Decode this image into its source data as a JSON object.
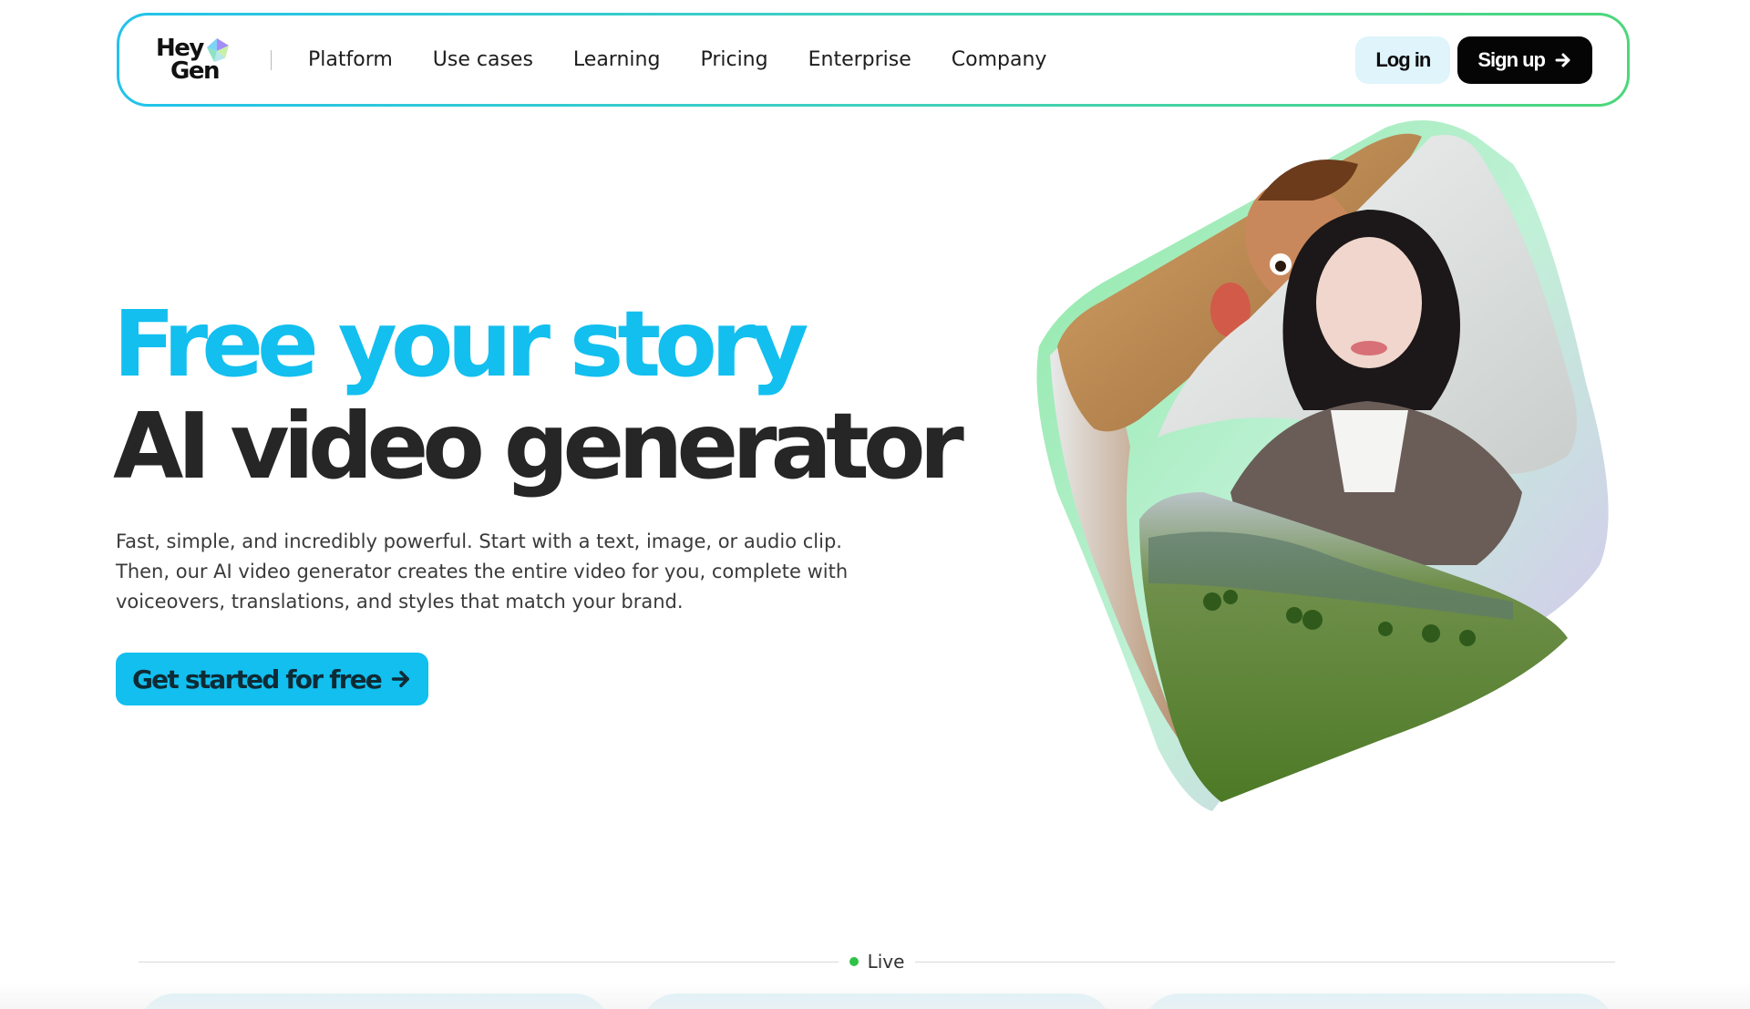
{
  "brand": {
    "logo_line1": "Hey",
    "logo_line2": "Gen",
    "accent": "#12bfef",
    "dark": "#262626",
    "live_green": "#2fc246"
  },
  "nav": {
    "links": [
      "Platform",
      "Use cases",
      "Learning",
      "Pricing",
      "Enterprise",
      "Company"
    ],
    "login_label": "Log in",
    "signup_label": "Sign up"
  },
  "hero": {
    "title_line1": "Free your story",
    "title_line2": "AI video generator",
    "description": "Fast, simple, and incredibly powerful. Start with a text, image, or audio clip. Then, our AI video generator creates the entire video for you, complete with voiceovers, translations, and styles that match your brand.",
    "cta_label": "Get started for free"
  },
  "live": {
    "label": "Live"
  },
  "icons": {
    "logo": "heygen-gem-icon",
    "arrow": "arrow-right-icon"
  }
}
